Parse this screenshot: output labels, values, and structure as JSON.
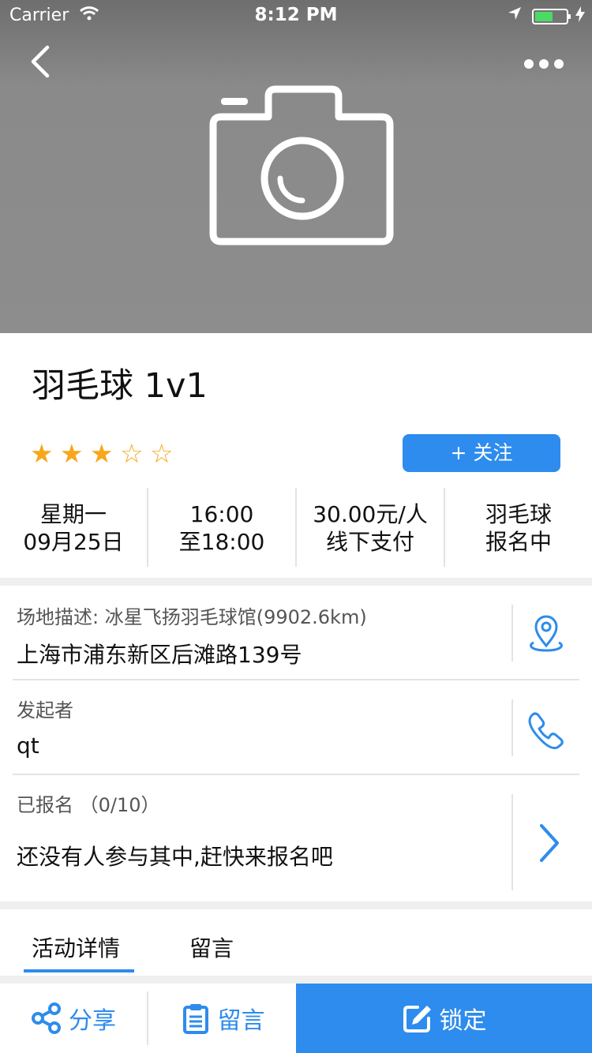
{
  "status_bar": {
    "carrier": "Carrier",
    "time": "8:12 PM"
  },
  "header": {
    "back_icon": "chevron-left-icon",
    "more_icon": "more-dots-icon",
    "cover_icon": "camera-icon"
  },
  "activity": {
    "title": "羽毛球 1v1",
    "rating": 3,
    "rating_max": 5,
    "follow_label": "+ 关注",
    "info": [
      {
        "line1": "星期一",
        "line2": "09月25日"
      },
      {
        "line1": "16:00",
        "line2": "至18:00"
      },
      {
        "line1": "30.00元/人",
        "line2": "线下支付"
      },
      {
        "line1": "羽毛球",
        "line2": "报名中"
      }
    ]
  },
  "details": {
    "venue_label": "场地描述: 冰星飞扬羽毛球馆(9902.6km)",
    "venue_address": "上海市浦东新区后滩路139号",
    "organizer_label": "发起者",
    "organizer_name": "qt",
    "signup_label": "已报名 （0/10）",
    "signup_text": "还没有人参与其中,赶快来报名吧"
  },
  "tabs": [
    {
      "label": "活动详情",
      "active": true
    },
    {
      "label": "留言",
      "active": false
    }
  ],
  "bottom_bar": {
    "share_label": "分享",
    "comment_label": "留言",
    "lock_label": "锁定"
  },
  "colors": {
    "accent": "#2d8ced",
    "star": "#f7a71c",
    "battery": "#4cd964"
  }
}
